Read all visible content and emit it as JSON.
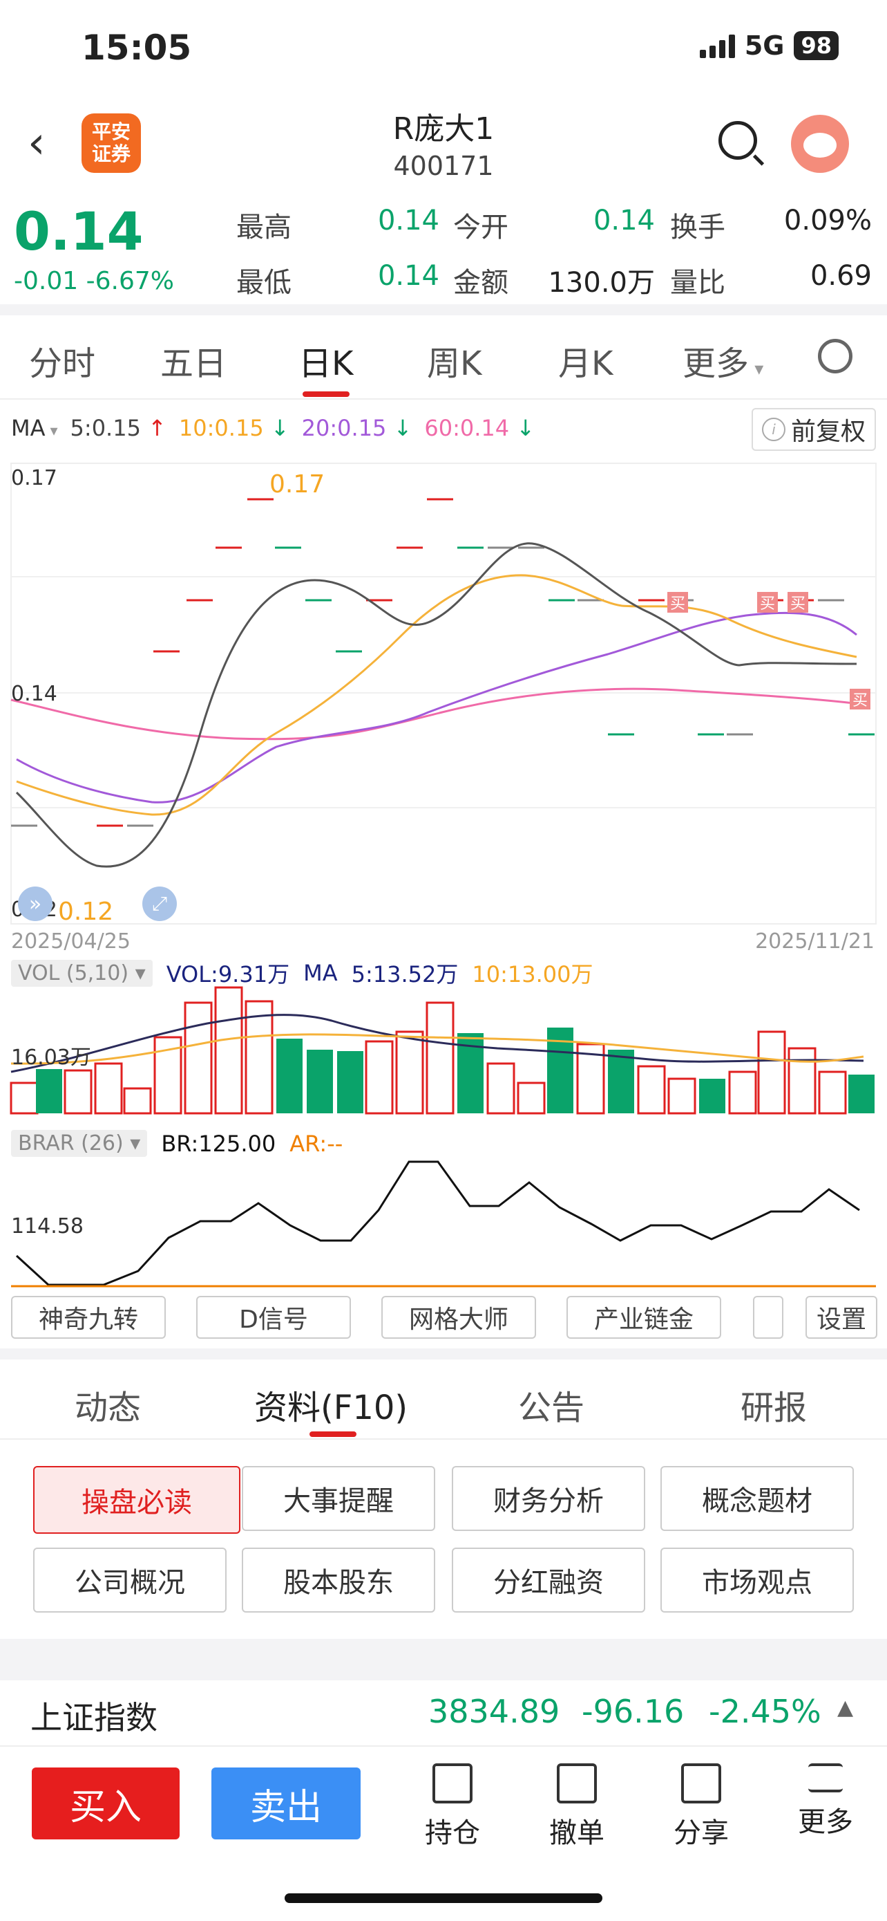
{
  "status": {
    "time": "15:05",
    "network": "5G",
    "battery": "98"
  },
  "header": {
    "logo_text": "平安\n证券",
    "title": "R庞大1",
    "code": "400171"
  },
  "quote": {
    "price": "0.14",
    "change": "-0.01",
    "change_pct": "-6.67%",
    "fields": [
      {
        "label": "最高",
        "value": "0.14"
      },
      {
        "label": "今开",
        "value": "0.14"
      },
      {
        "label": "换手",
        "value": "0.09%"
      },
      {
        "label": "最低",
        "value": "0.14"
      },
      {
        "label": "金额",
        "value": "130.0万"
      },
      {
        "label": "量比",
        "value": "0.69"
      }
    ]
  },
  "period_tabs": [
    "分时",
    "五日",
    "日K",
    "周K",
    "月K",
    "更多"
  ],
  "active_tab": "日K",
  "ma_bar": {
    "label": "MA",
    "ma5": "5:0.15",
    "ma10": "10:0.15",
    "ma20": "20:0.15",
    "ma60": "60:0.14",
    "adjust": "前复权"
  },
  "kchart": {
    "y_labels": [
      "0.17",
      "0.14",
      "0.12"
    ],
    "max_annot": "0.17",
    "min_annot": "0.12",
    "start_date": "2025/04/25",
    "end_date": "2025/11/21",
    "buy_mark": "买"
  },
  "vol": {
    "name": "VOL (5,10)",
    "vol": "VOL:9.31万",
    "ma_label": "MA",
    "ma5": "5:13.52万",
    "ma10": "10:13.00万",
    "y_label": "16.03万"
  },
  "brar": {
    "name": "BRAR (26)",
    "br": "BR:125.00",
    "ar": "AR:--",
    "y_label": "114.58"
  },
  "tools": [
    "神奇九转",
    "D信号",
    "网格大师",
    "产业链金",
    "",
    "设置"
  ],
  "sections": [
    "动态",
    "资料(F10)",
    "公告",
    "研报"
  ],
  "f10_buttons": [
    "操盘必读",
    "大事提醒",
    "财务分析",
    "概念题材",
    "公司概况",
    "股本股东",
    "分红融资",
    "市场观点"
  ],
  "index_bar": {
    "name": "上证指数",
    "value": "3834.89",
    "change": "-96.16",
    "pct": "-2.45%"
  },
  "bottom": {
    "buy": "买入",
    "sell": "卖出",
    "items": [
      "持仓",
      "撤单",
      "分享",
      "更多"
    ]
  },
  "colors": {
    "up": "#e02020",
    "down": "#0aa36a",
    "ma5": "#444444",
    "ma10": "#f5a623",
    "ma20": "#a259d9",
    "ma60": "#f06aa8"
  }
}
